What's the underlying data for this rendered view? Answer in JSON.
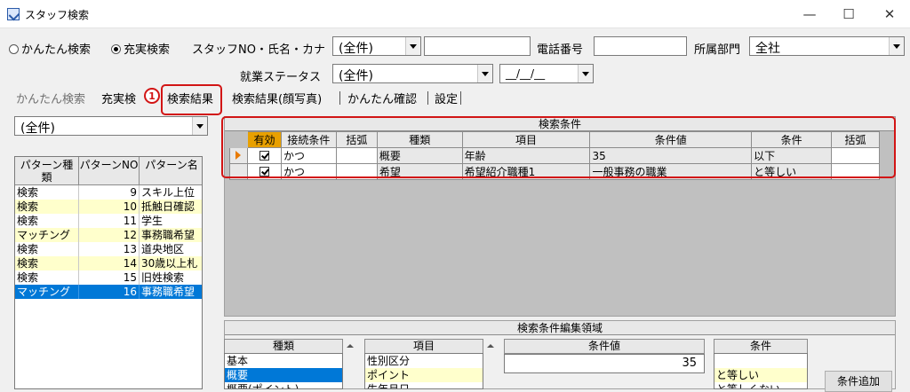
{
  "window": {
    "title": "スタッフ検索",
    "minimize": "—",
    "maximize": "☐",
    "close": "✕"
  },
  "search_mode": {
    "option_simple": "かんたん検索",
    "option_full": "充実検索",
    "selected": "option_full"
  },
  "filters": {
    "staff_label": "スタッフNO・氏名・カナ",
    "staff_combo": "(全件)",
    "staff_text": "",
    "phone_label": "電話番号",
    "phone_value": "",
    "dept_label": "所属部門",
    "dept_value": "全社",
    "employment_label": "就業ステータス",
    "employment_combo": "(全件)",
    "date_value": "__/__/__"
  },
  "tabs": [
    "かんたん検索",
    "充実検",
    "検索結果",
    "検索結果(顔写真)",
    "かんたん確認",
    "設定"
  ],
  "annotation_badge": "1",
  "pattern_combo": "(全件)",
  "pattern_list": {
    "headers": [
      "パターン種類",
      "パターンNO",
      "パターン名"
    ],
    "rows": [
      {
        "type": "検索",
        "no": "9",
        "name": "スキル上位"
      },
      {
        "type": "検索",
        "no": "10",
        "name": "抵触日確認"
      },
      {
        "type": "検索",
        "no": "11",
        "name": "学生"
      },
      {
        "type": "マッチング",
        "no": "12",
        "name": "事務職希望"
      },
      {
        "type": "検索",
        "no": "13",
        "name": "道央地区"
      },
      {
        "type": "検索",
        "no": "14",
        "name": "30歳以上札"
      },
      {
        "type": "検索",
        "no": "15",
        "name": "旧姓検索"
      },
      {
        "type": "マッチング",
        "no": "16",
        "name": "事務職希望"
      }
    ]
  },
  "conditions": {
    "title": "検索条件",
    "headers": [
      "有効",
      "接続条件",
      "括弧",
      "種類",
      "項目",
      "条件値",
      "条件",
      "括弧"
    ],
    "rows": [
      {
        "enabled": true,
        "join": "かつ",
        "paren_open": "",
        "kind": "概要",
        "item": "年齢",
        "value": "35",
        "cond": "以下",
        "paren_close": ""
      },
      {
        "enabled": true,
        "join": "かつ",
        "paren_open": "",
        "kind": "希望",
        "item": "希望紹介職種1",
        "value": "一般事務の職業",
        "cond": "と等しい",
        "paren_close": ""
      }
    ]
  },
  "editor": {
    "title": "検索条件編集領域",
    "kind_header": "種類",
    "kind_items": [
      "基本",
      "概要",
      "概要(ポイント)"
    ],
    "item_header": "項目",
    "item_items": [
      "性別区分",
      "ポイント",
      "生年月日"
    ],
    "value_header": "条件値",
    "value_input": "35",
    "cond_header": "条件",
    "cond_items": [
      "",
      "と等しい",
      "と等しくない"
    ],
    "add_button": "条件追加"
  }
}
